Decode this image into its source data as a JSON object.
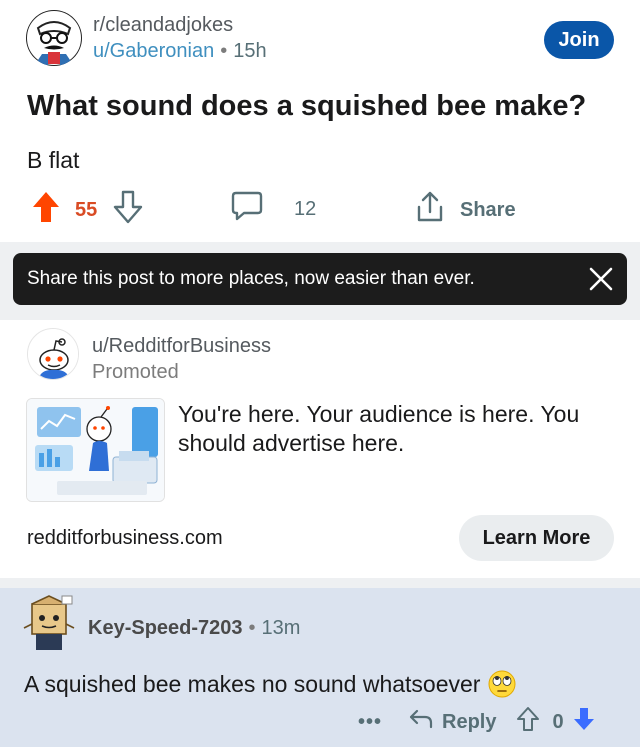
{
  "post": {
    "subreddit": "r/cleandadjokes",
    "author": "u/Gaberonian",
    "separator": "•",
    "time": "15h",
    "join_label": "Join",
    "title": "What sound does a squished bee make?",
    "body": "B flat",
    "votes": "55",
    "comments": "12",
    "share_label": "Share"
  },
  "toast": {
    "text": "Share this post to more places, now easier than ever."
  },
  "promo": {
    "author": "u/RedditforBusiness",
    "promoted": "Promoted",
    "headline": "You're here. Your audience is here. You should advertise here.",
    "domain": "redditforbusiness.com",
    "cta": "Learn More"
  },
  "comment": {
    "author": "Key-Speed-7203",
    "separator": "•",
    "time": "13m",
    "body": "A squished bee makes no sound whatsoever",
    "more": "•••",
    "reply_label": "Reply",
    "votes": "0"
  },
  "colors": {
    "upvote_active": "#ff4500",
    "downvote_active": "#3a6cff",
    "join_button": "#0a56a8",
    "author_link": "#3f8fbf",
    "comment_highlight": "#dbe3ef"
  },
  "icons": [
    "subreddit-avatar",
    "upvote-icon",
    "downvote-icon",
    "comment-icon",
    "share-icon",
    "close-icon",
    "reddit-snoo-avatar",
    "user-avatar",
    "eye-roll-emoji",
    "reply-icon"
  ]
}
